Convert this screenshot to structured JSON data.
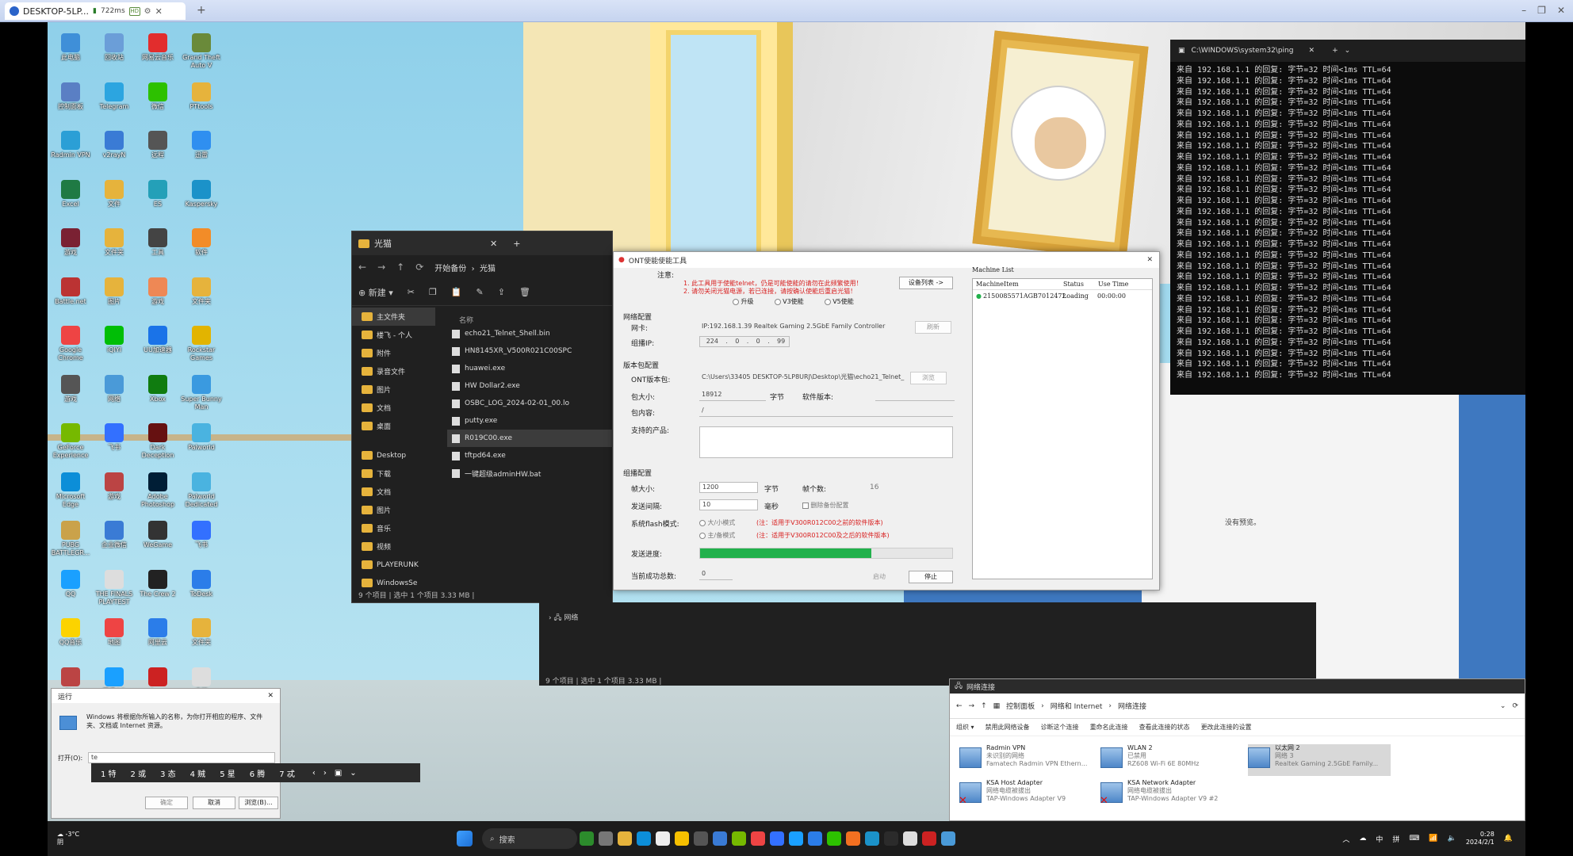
{
  "browser": {
    "tab_title": "DESKTOP-5LP...",
    "latency": "722ms",
    "badge": "HD"
  },
  "desktop_icons": [
    {
      "label": "此电脑",
      "color": "#3f8fd8"
    },
    {
      "label": "回收站",
      "color": "#6b9ed8"
    },
    {
      "label": "网易云音乐",
      "color": "#e22d2d"
    },
    {
      "label": "Grand Theft Auto V",
      "color": "#6a8a3a"
    },
    {
      "label": "控制面板",
      "color": "#5a7fc4"
    },
    {
      "label": "Telegram",
      "color": "#2ca5e0"
    },
    {
      "label": "微信",
      "color": "#2dc100"
    },
    {
      "label": "PTtools",
      "color": "#e6b33c"
    },
    {
      "label": "Radmin VPN",
      "color": "#2b9fd6"
    },
    {
      "label": "v2rayN",
      "color": "#3a7bd5"
    },
    {
      "label": "远程",
      "color": "#555"
    },
    {
      "label": "迅雷",
      "color": "#2f8ff0"
    },
    {
      "label": "Excel",
      "color": "#1f7a44"
    },
    {
      "label": "文件",
      "color": "#e6b33c"
    },
    {
      "label": "ES",
      "color": "#24a0b8"
    },
    {
      "label": "Kaspersky",
      "color": "#1b92c9"
    },
    {
      "label": "游戏",
      "color": "#7a2133"
    },
    {
      "label": "文件夹",
      "color": "#e6b33c"
    },
    {
      "label": "工具",
      "color": "#444"
    },
    {
      "label": "软件",
      "color": "#f28c28"
    },
    {
      "label": "Battle.net",
      "color": "#b33"
    },
    {
      "label": "图片",
      "color": "#e6b33c"
    },
    {
      "label": "游戏",
      "color": "#e85"
    },
    {
      "label": "文件夹",
      "color": "#e6b33c"
    },
    {
      "label": "Google Chrome",
      "color": "#e44"
    },
    {
      "label": "iQIYI",
      "color": "#00be06"
    },
    {
      "label": "UU加速器",
      "color": "#1a73e8"
    },
    {
      "label": "Rockstar Games",
      "color": "#e2b400"
    },
    {
      "label": "游戏",
      "color": "#555"
    },
    {
      "label": "网络",
      "color": "#4a9ad8"
    },
    {
      "label": "Xbox",
      "color": "#107c10"
    },
    {
      "label": "Super Bunny Man",
      "color": "#3a9ae0"
    },
    {
      "label": "GeForce Experience",
      "color": "#76b900"
    },
    {
      "label": "飞书",
      "color": "#3370ff"
    },
    {
      "label": "Dark Deception",
      "color": "#611"
    },
    {
      "label": "Palworld",
      "color": "#4ab3e0"
    },
    {
      "label": "Microsoft Edge",
      "color": "#0c8ed8"
    },
    {
      "label": "游戏",
      "color": "#b44"
    },
    {
      "label": "Adobe Photoshop",
      "color": "#001e36"
    },
    {
      "label": "Palworld Dedicated",
      "color": "#4ab3e0"
    },
    {
      "label": "PUBG BATTLEGR...",
      "color": "#caa24a"
    },
    {
      "label": "企业微信",
      "color": "#3a7bd5"
    },
    {
      "label": "WeGame",
      "color": "#333"
    },
    {
      "label": "飞书",
      "color": "#3370ff"
    },
    {
      "label": "QQ",
      "color": "#1aa0ff"
    },
    {
      "label": "THE FINALS PLAYTEST",
      "color": "#ddd"
    },
    {
      "label": "The Crew 2",
      "color": "#222"
    },
    {
      "label": "ToDesk",
      "color": "#2b7de9"
    },
    {
      "label": "QQ音乐",
      "color": "#fcd300"
    },
    {
      "label": "地图",
      "color": "#e44"
    },
    {
      "label": "阿里云",
      "color": "#2b7de9"
    },
    {
      "label": "文件夹",
      "color": "#e6b33c"
    },
    {
      "label": "Sky",
      "color": "#b44"
    },
    {
      "label": "腾讯QQ",
      "color": "#1aa0ff"
    },
    {
      "label": "Apex",
      "color": "#c22"
    },
    {
      "label": "文档",
      "color": "#ddd"
    }
  ],
  "explorer": {
    "title": "光猫",
    "path_crumbs": [
      "开始备份",
      "光猫"
    ],
    "new_label": "新建",
    "column_name": "名称",
    "sidebar": [
      "主文件夹",
      "楼飞 - 个人",
      "附件",
      "录音文件",
      "图片",
      "文档",
      "桌面",
      "Desktop",
      "下载",
      "文档",
      "图片",
      "音乐",
      "视频",
      "PLAYERUNK",
      "WindowsSe"
    ],
    "files": [
      "echo21_Telnet_Shell.bin",
      "HN8145XR_V500R021C00SPC",
      "huawei.exe",
      "HW Dollar2.exe",
      "OSBC_LOG_2024-02-01_00.lo",
      "putty.exe",
      "R019C00.exe",
      "tftpd64.exe",
      "一键超级adminHW.bat"
    ],
    "status": "9 个项目  |  选中 1 个项目 3.33 MB  |",
    "status2": "9 个项目  |  选中 1 个项目 3.33 MB  |",
    "net_label": "网络"
  },
  "ont_tool": {
    "title": "ONT使能使能工具",
    "notice_label": "注意:",
    "notice_1": "1. 此工具用于使能telnet，仍是可能使能的请勿在此频繁使用！",
    "notice_2": "2. 请勿关闭光猫电源，若已连接，请按确认使能后重启光猫！",
    "mode_options": [
      "升级",
      "V3使能",
      "V5使能"
    ],
    "device_list_button": "设备列表 ->",
    "net_section": "网络配置",
    "nic_label": "网卡:",
    "nic_value": "IP:192.168.1.39 Realtek Gaming 2.5GbE Family Controller",
    "refresh_button": "刷新",
    "multicast_label": "组播IP:",
    "multicast_ip": [
      "224",
      "0",
      "0",
      "99"
    ],
    "pkg_section": "版本包配置",
    "ont_pkg_label": "ONT版本包:",
    "ont_pkg_value": "C:\\Users\\33405 DESKTOP-5LP8URJ\\Desktop\\光猫\\echo21_Telnet_",
    "browse_button": "浏览",
    "size_label": "包大小:",
    "size_value": "18912",
    "size_unit": "字节",
    "software_version_label": "软件版本:",
    "header_label": "包内容:",
    "header_value": "/",
    "products_label": "支持的产品:",
    "mc_section": "组播配置",
    "frame_size_label": "帧大小:",
    "frame_size_value": "1200",
    "frame_unit": "字节",
    "frame_count_label": "帧个数:",
    "frame_count_value": "16",
    "interval_label": "发送间隔:",
    "interval_value": "10",
    "interval_unit": "毫秒",
    "dedup_label": "删除备份配置",
    "flash_mode_label": "系统flash模式:",
    "flash_opt1": "大/小模式",
    "flash_opt1_note": "(注：适用于V300R012C00之前的软件版本)",
    "flash_opt2": "主/备模式",
    "flash_opt2_note": "(注：适用于V300R012C00及之后的软件版本)",
    "progress_label": "发送进度:",
    "progress": 0.68,
    "success_label": "当前成功总数:",
    "success_value": "0",
    "start_button": "启动",
    "stop_button": "停止",
    "machine_list_title": "Machine List",
    "machine_columns": [
      "MachineItem",
      "Status",
      "Use Time"
    ],
    "machines": [
      {
        "item": "2150085571AGB7012472",
        "status": "Loading",
        "time": "00:00:00"
      }
    ],
    "accent": "#22b14c"
  },
  "cmd": {
    "title": "C:\\WINDOWS\\system32\\ping",
    "line": "来自 192.168.1.1 的回复: 字节=32 时间<1ms TTL=64",
    "line_count": 29
  },
  "netconn": {
    "title": "网络连接",
    "crumbs": [
      "控制面板",
      "网络和 Internet",
      "网络连接"
    ],
    "commands": [
      "组织 ▾",
      "禁用此网络设备",
      "诊断这个连接",
      "重命名此连接",
      "查看此连接的状态",
      "更改此连接的设置"
    ],
    "adapters": [
      {
        "name": "Radmin VPN",
        "status": "未识别的网络",
        "device": "Famatech Radmin VPN Ethern...",
        "disabled": false,
        "selected": false
      },
      {
        "name": "WLAN 2",
        "status": "已禁用",
        "device": "RZ608 Wi-Fi 6E 80MHz",
        "disabled": false,
        "selected": false
      },
      {
        "name": "以太网 2",
        "status": "网络 3",
        "device": "Realtek Gaming 2.5GbE Family...",
        "disabled": false,
        "selected": true
      },
      {
        "name": "KSA Host Adapter",
        "status": "网络电缆被拔出",
        "device": "TAP-Windows Adapter V9",
        "disabled": true,
        "selected": false
      },
      {
        "name": "KSA Network Adapter",
        "status": "网络电缆被拔出",
        "device": "TAP-Windows Adapter V9 #2",
        "disabled": true,
        "selected": false
      }
    ],
    "no_preview": "没有预览。"
  },
  "run_dialog": {
    "title": "运行",
    "desc": "Windows 将根据你所输入的名称，为你打开相应的程序、文件夹、文档或 Internet 资源。",
    "open_label": "打开(O):",
    "input_value": "te",
    "ok": "确定",
    "cancel": "取消",
    "browse": "浏览(B)..."
  },
  "ime": {
    "candidates": [
      "1 特",
      "2 或",
      "3 态",
      "4 贼",
      "5 星",
      "6 腾",
      "7 忒"
    ]
  },
  "taskbar": {
    "weather": "-3°C",
    "weather_sub": "阴",
    "search": "搜索",
    "time": "0:28",
    "date": "2024/2/1",
    "lang": "中",
    "ime_mode": "拼"
  }
}
